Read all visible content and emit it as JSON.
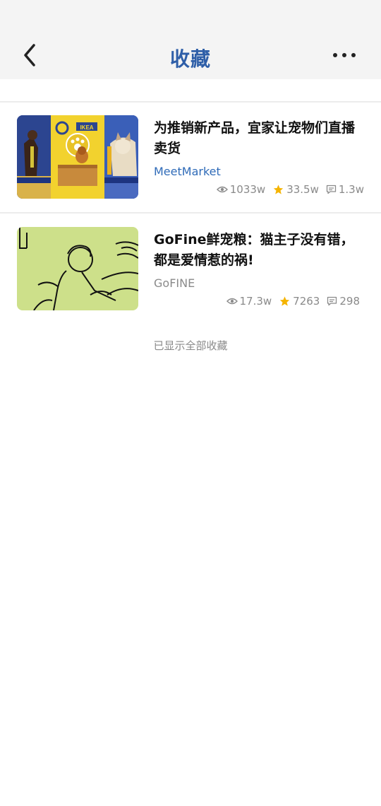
{
  "header": {
    "title": "收藏",
    "back_icon": "chevron-left-icon",
    "more_icon": "more-horizontal-icon"
  },
  "items": [
    {
      "title": "为推销新产品，宜家让宠物们直播卖货",
      "source": "MeetMarket",
      "source_color": "#2f6bb8",
      "views": "1033w",
      "stars": "33.5w",
      "comments": "1.3w",
      "thumbnail": "ikea-pets-image",
      "thumb_logo": "IKEA"
    },
    {
      "title": "GoFine鲜宠粮：猫主子没有错，都是爱情惹的祸!",
      "source": "GoFINE",
      "source_color": "#8a8a8a",
      "views": "17.3w",
      "stars": "7263",
      "comments": "298",
      "thumbnail": "line-illustration-image"
    }
  ],
  "footer": {
    "note": "已显示全部收藏"
  },
  "colors": {
    "accent": "#2f5fa8",
    "star": "#f5b400",
    "muted": "#8a8a8a",
    "header_bg": "#f4f4f4"
  }
}
